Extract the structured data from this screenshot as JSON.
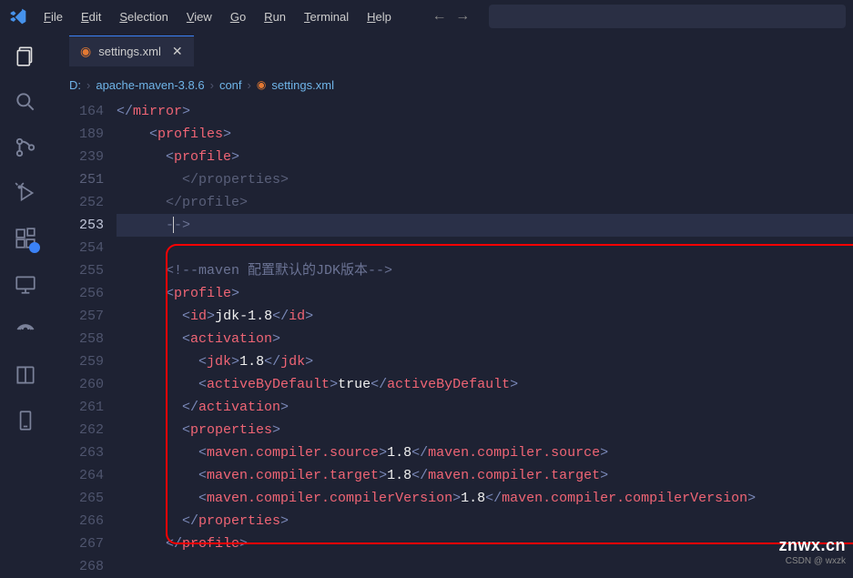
{
  "menu": {
    "file": "File",
    "edit": "Edit",
    "selection": "Selection",
    "view": "View",
    "go": "Go",
    "run": "Run",
    "terminal": "Terminal",
    "help": "Help"
  },
  "tab": {
    "label": "settings.xml"
  },
  "breadcrumb": {
    "drive": "D:",
    "p1": "apache-maven-3.8.6",
    "p2": "conf",
    "p3": "settings.xml"
  },
  "gutter": [
    "164",
    "189",
    "239",
    "251",
    "252",
    "253",
    "254",
    "255",
    "256",
    "257",
    "258",
    "259",
    "260",
    "261",
    "262",
    "263",
    "264",
    "265",
    "266",
    "267",
    "268"
  ],
  "code": {
    "mirror_close": "mirror",
    "profiles_open": "profiles",
    "profile_open": "profile",
    "properties_close_dim": "properties",
    "profile_close_dim": "profile",
    "arrow_end": "-->",
    "comment": "<!--maven 配置默认的JDK版本-->",
    "profile": "profile",
    "id": "id",
    "id_val": "jdk-1.8",
    "activation": "activation",
    "jdk": "jdk",
    "jdk_val": "1.8",
    "abd": "activeByDefault",
    "abd_val": "true",
    "properties": "properties",
    "mcs": "maven.compiler.source",
    "mcs_val": "1.8",
    "mct": "maven.compiler.target",
    "mct_val": "1.8",
    "mcv": "maven.compiler.compilerVersion",
    "mcv_val": "1.8"
  },
  "watermark": "znwx.cn",
  "watermark2": "CSDN @ wxzk"
}
